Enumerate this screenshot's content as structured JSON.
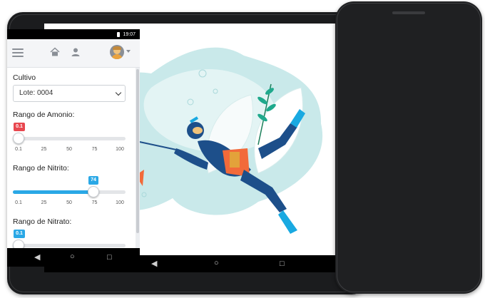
{
  "phone": {
    "status_time": "19:07",
    "form": {
      "cultivo_label": "Cultivo",
      "cultivo_selected": "Lote: 0004",
      "amonio": {
        "label": "Rango de Amonio:",
        "value_label": "0.1",
        "value": 0.1,
        "badge_color": "#e8474f"
      },
      "nitrito": {
        "label": "Rango de Nitrito:",
        "value_label": "74",
        "value": 74,
        "badge_color": "#2aa8e6"
      },
      "nitrato": {
        "label": "Rango de Nitrato:",
        "value_label": "0.1",
        "value": 0.1,
        "badge_color": "#2aa8e6"
      },
      "scale_ticks": [
        "0.1",
        "25",
        "50",
        "75",
        "100"
      ]
    }
  },
  "tablet": {
    "illustration": "diver-with-trident-fish-icon"
  },
  "colors": {
    "accent": "#2aa8e6",
    "danger_badge": "#e8474f",
    "water_blob": "#c9e9ea",
    "diver_suit": "#1d4f8a",
    "diver_accent": "#f26a3a",
    "fins": "#19a9e1"
  }
}
